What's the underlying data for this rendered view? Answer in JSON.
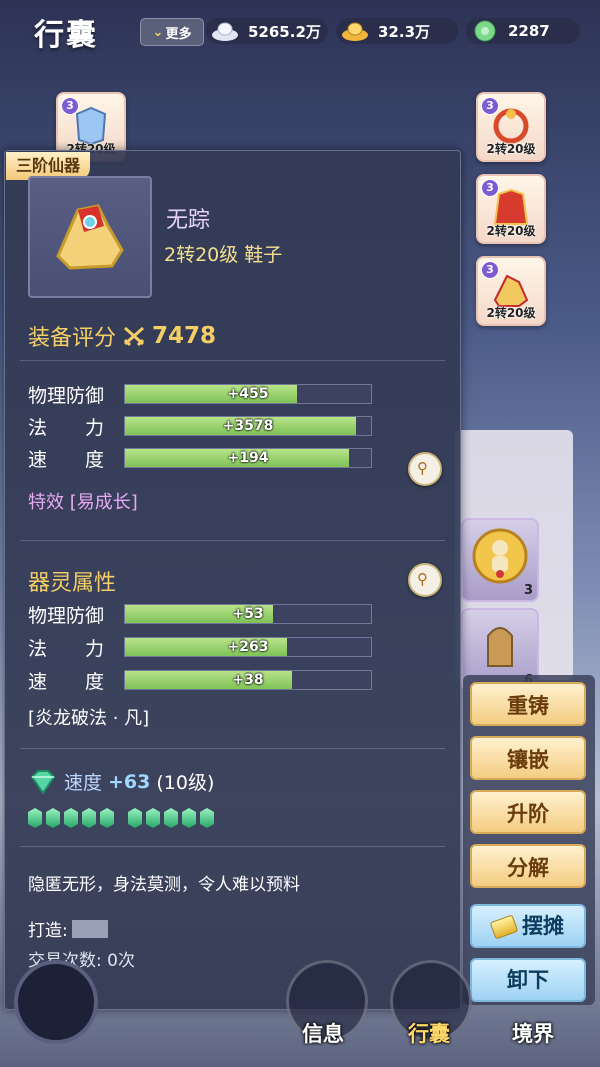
{
  "topbar": {
    "title": "行囊",
    "more_label": "更多",
    "currencies": [
      {
        "icon": "silver-ingot-icon",
        "value": "5265.2万"
      },
      {
        "icon": "gold-ingot-icon",
        "value": "32.3万"
      },
      {
        "icon": "jade-coin-icon",
        "value": "2287"
      }
    ]
  },
  "equip_slots": [
    {
      "tier": "3",
      "caption": "2转20级"
    },
    {
      "tier": "3",
      "caption": "2转20级"
    },
    {
      "tier": "3",
      "caption": "2转20级"
    },
    {
      "tier": "3",
      "caption": "2转20级"
    }
  ],
  "bag_counts": [
    "3",
    "6"
  ],
  "item": {
    "tier_tag": "三阶仙器",
    "name": "无踪",
    "level_type": "2转20级 鞋子",
    "score_label": "装备评分",
    "score_value": "7478",
    "stats": [
      {
        "label": "物理防御",
        "value": "+455",
        "fill": 0.7
      },
      {
        "label": "法　　力",
        "value": "+3578",
        "fill": 0.94
      },
      {
        "label": "速　　度",
        "value": "+194",
        "fill": 0.91
      }
    ],
    "effect": "特效 [易成长]",
    "soul_title": "器灵属性",
    "soul_stats": [
      {
        "label": "物理防御",
        "value": "+53",
        "fill": 0.6
      },
      {
        "label": "法　　力",
        "value": "+263",
        "fill": 0.66
      },
      {
        "label": "速　　度",
        "value": "+38",
        "fill": 0.68
      }
    ],
    "soul_skill": "[炎龙破法 · 凡]",
    "gem": {
      "stat": "速度",
      "bonus": "+63",
      "level": "(10级)"
    },
    "description": "隐匿无形，身法莫测，令人难以预料",
    "forge_label": "打造:",
    "trade_label": "交易次数: 0次"
  },
  "actions": {
    "recast": "重铸",
    "inlay": "镶嵌",
    "upgrade": "升阶",
    "decompose": "分解",
    "stall": "摆摊",
    "unequip": "卸下"
  },
  "nav": {
    "info": "信息",
    "bag": "行囊",
    "realm": "境界"
  },
  "colors": {
    "panel_bg": "#343a54",
    "score_gold": "#f5cf66",
    "bar_green": "#8fd068",
    "effect_purple": "#e6a9f2",
    "action_gold": "#f4cd82",
    "action_blue": "#9ed2f3"
  }
}
